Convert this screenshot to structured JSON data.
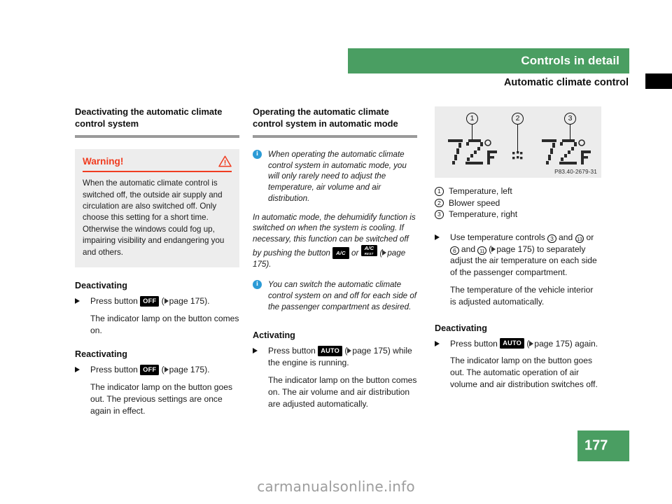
{
  "header": {
    "band_title": "Controls in detail",
    "section_subtitle": "Automatic climate control"
  },
  "page_number": "177",
  "watermark": "carmanualsonline.info",
  "colors": {
    "brand_green": "#4a9e62",
    "warning_red": "#f03c20",
    "info_blue": "#2b9bd6",
    "rule_gray": "#9a9a9a",
    "box_gray": "#ededed"
  },
  "column1": {
    "heading": "Deactivating the automatic climate control system",
    "warning": {
      "title": "Warning!",
      "icon": "warning-triangle-icon",
      "body": "When the automatic climate control is switched off, the outside air supply and circulation are also switched off. Only choose this setting for a short time. Otherwise the windows could fog up, impairing visibility and endangering you and others."
    },
    "deactivating": {
      "heading": "Deactivating",
      "step_prefix": "Press button",
      "button_label": "OFF",
      "step_suffix": "page 175).",
      "result": "The indicator lamp on the button comes on."
    },
    "reactivating": {
      "heading": "Reactivating",
      "step_prefix": "Press button",
      "button_label": "OFF",
      "step_suffix": "page 175).",
      "result": "The indicator lamp on the button goes out. The previous settings are once again in effect."
    }
  },
  "column2": {
    "heading": "Operating the automatic climate control system in automatic mode",
    "note1": "When operating the automatic climate control system in automatic mode, you will only rarely need to adjust the temperature, air volume and air distribution.",
    "note1_cont_a": "In automatic mode, the dehumidify function is switched on when the system is cooling. If necessary, this function can be switched off by pushing the button",
    "note1_cont_or": "or",
    "note1_cont_b": "page 175).",
    "ac_button_label": "A/C",
    "ac_button2_label": "A/C",
    "ac_button2_sub": "REST",
    "note2": "You can switch the automatic climate control system on and off for each side of the passenger compartment as desired.",
    "activating": {
      "heading": "Activating",
      "step_prefix": "Press button",
      "button_label": "AUTO",
      "step_suffix": "page 175) while the engine is running.",
      "result": "The indicator lamp on the button comes on. The air volume and air distribution are adjusted automatically."
    }
  },
  "column3": {
    "figure": {
      "code": "P83.40-2679-31",
      "callouts": [
        "1",
        "2",
        "3"
      ],
      "lcd_left": "72°F",
      "lcd_right": "72°F",
      "lcd_mid": "blower-bars"
    },
    "legend": [
      {
        "num": "1",
        "label": "Temperature, left"
      },
      {
        "num": "2",
        "label": "Blower speed"
      },
      {
        "num": "3",
        "label": "Temperature, right"
      }
    ],
    "temp_step": {
      "text_a": "Use temperature controls",
      "ref_1": "3",
      "text_b": "and",
      "ref_2": "13",
      "text_c": "or",
      "ref_3": "6",
      "text_d": "and",
      "ref_4": "11",
      "text_e": "page 175) to separately adjust the air temperature on each side of the passenger compartment."
    },
    "temp_result": "The temperature of the vehicle interior is adjusted automatically.",
    "deactivating": {
      "heading": "Deactivating",
      "step_prefix": "Press button",
      "button_label": "AUTO",
      "step_suffix": "page 175) again.",
      "result": "The indicator lamp on the button goes out. The automatic operation of air volume and air distribution switches off."
    }
  }
}
